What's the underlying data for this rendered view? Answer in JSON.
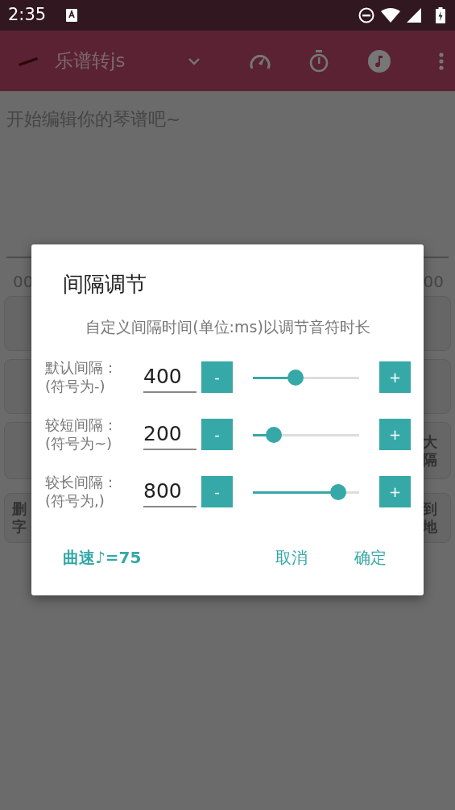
{
  "status_bar": {
    "time": "2:35"
  },
  "app_bar": {
    "title": "乐谱转js"
  },
  "editor": {
    "placeholder": "开始编辑你的琴谱吧~"
  },
  "timeline": {
    "start": "00",
    "end": "00"
  },
  "keys": [
    {
      "label": "大隔"
    },
    {
      "label": "删字"
    },
    {
      "label": "到地"
    }
  ],
  "dialog": {
    "title": "间隔调节",
    "message": "自定义间隔时间(单位:ms)以调节音符时长",
    "rows": [
      {
        "label": "默认间隔：",
        "hint": "(符号为-)",
        "value": "400",
        "minus": "-",
        "plus": "+",
        "level": 0.4
      },
      {
        "label": "较短间隔：",
        "hint": "(符号为~)",
        "value": "200",
        "minus": "-",
        "plus": "+",
        "level": 0.2
      },
      {
        "label": "较长间隔：",
        "hint": "(符号为,)",
        "value": "800",
        "minus": "-",
        "plus": "+",
        "level": 0.8
      }
    ],
    "tempo": "曲速♪=75",
    "buttons": [
      "取消",
      "确定"
    ]
  }
}
